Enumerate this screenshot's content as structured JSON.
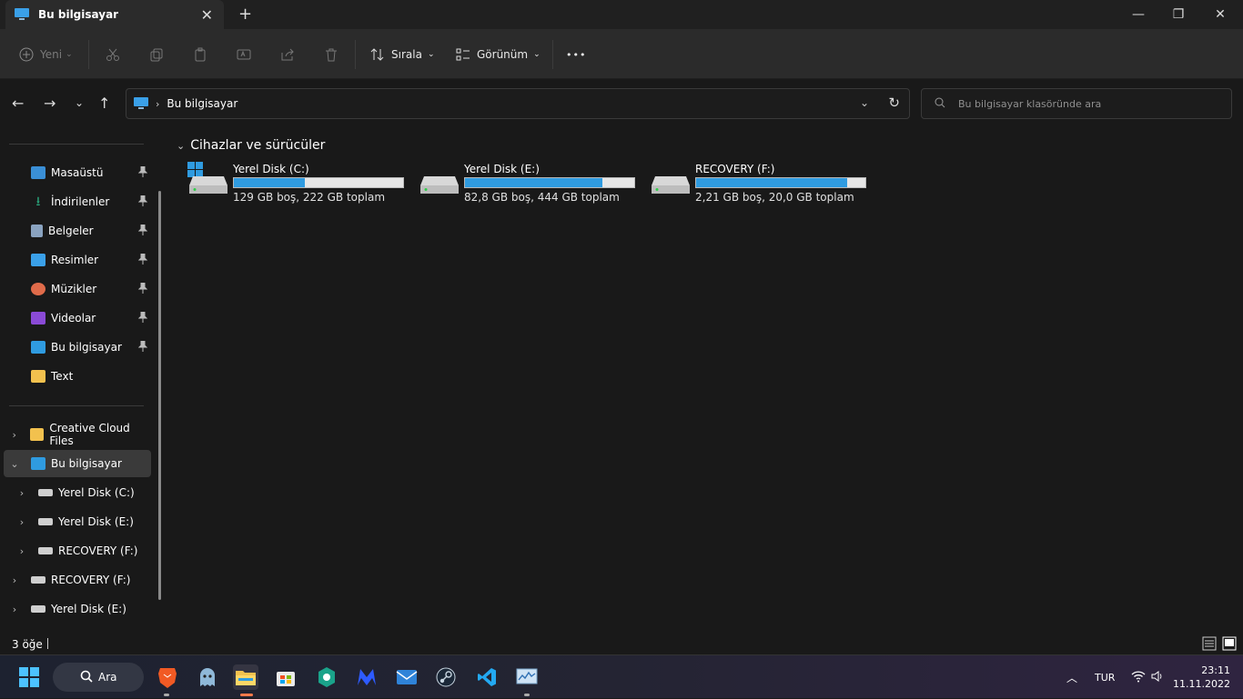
{
  "window": {
    "tab_title": "Bu bilgisayar",
    "new_tab": "+",
    "controls": {
      "minimize": "—",
      "maximize": "❐",
      "close": "✕"
    }
  },
  "toolbar": {
    "new_label": "Yeni",
    "sort_label": "Sırala",
    "view_label": "Görünüm",
    "more_label": "•••"
  },
  "address": {
    "breadcrumb": "Bu bilgisayar",
    "search_placeholder": "Bu bilgisayar klasöründe ara"
  },
  "sidebar": {
    "pinned": [
      {
        "label": "Masaüstü",
        "icon": "desktop-icon",
        "color": "#3a8fd6"
      },
      {
        "label": "İndirilenler",
        "icon": "download-icon",
        "color": "#2aa37a"
      },
      {
        "label": "Belgeler",
        "icon": "document-icon",
        "color": "#8aa3c0"
      },
      {
        "label": "Resimler",
        "icon": "pictures-icon",
        "color": "#3aa0e8"
      },
      {
        "label": "Müzikler",
        "icon": "music-icon",
        "color": "#e06b4a"
      },
      {
        "label": "Videolar",
        "icon": "video-icon",
        "color": "#8a4ad6"
      },
      {
        "label": "Bu bilgisayar",
        "icon": "computer-icon",
        "color": "#2f9be0"
      },
      {
        "label": "Text",
        "icon": "folder-icon",
        "color": "#f2c14e"
      }
    ],
    "tree": [
      {
        "label": "Creative Cloud Files",
        "chevron": "›",
        "icon": "creative-cloud-folder-icon"
      },
      {
        "label": "Bu bilgisayar",
        "chevron": "⌄",
        "icon": "computer-icon"
      },
      {
        "label": "Yerel Disk (C:)",
        "chevron": "›",
        "icon": "windows-drive-icon"
      },
      {
        "label": "Yerel Disk (E:)",
        "chevron": "›",
        "icon": "drive-icon"
      },
      {
        "label": "RECOVERY (F:)",
        "chevron": "›",
        "icon": "drive-icon"
      },
      {
        "label": "RECOVERY (F:)",
        "chevron": "›",
        "icon": "drive-icon"
      },
      {
        "label": "Yerel Disk (E:)",
        "chevron": "›",
        "icon": "drive-icon"
      }
    ]
  },
  "content": {
    "section_title": "Cihazlar ve sürücüler",
    "drives": [
      {
        "name": "Yerel Disk (C:)",
        "info": "129 GB boş, 222 GB toplam",
        "used_fraction": 0.42
      },
      {
        "name": "Yerel Disk (E:)",
        "info": "82,8 GB boş, 444 GB toplam",
        "used_fraction": 0.81
      },
      {
        "name": "RECOVERY (F:)",
        "info": "2,21 GB boş, 20,0 GB toplam",
        "used_fraction": 0.89
      }
    ]
  },
  "status": {
    "item_count": "3 öğe"
  },
  "taskbar": {
    "search_label": "Ara",
    "language": "TUR",
    "time": "23:11",
    "date": "11.11.2022"
  }
}
